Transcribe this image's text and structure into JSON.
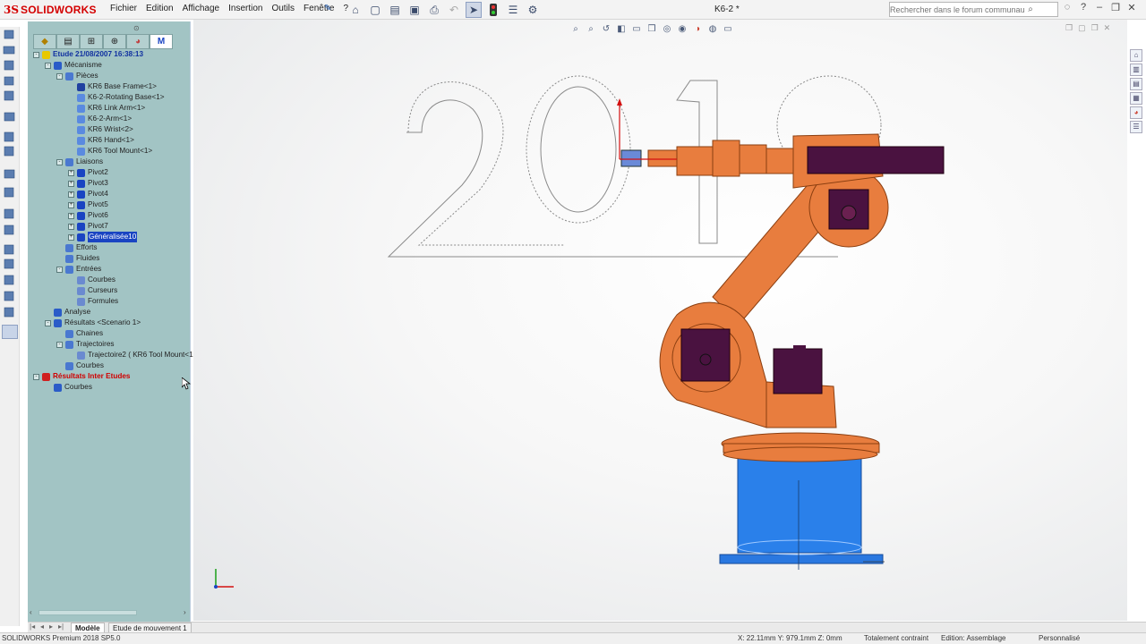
{
  "app": {
    "logo_ds": "3S",
    "logo_name": "SOLIDWORKS",
    "doc_title": "K6-2 *",
    "search_placeholder": "Rechercher dans le forum communautaire"
  },
  "menus": [
    "Fichier",
    "Edition",
    "Affichage",
    "Insertion",
    "Outils",
    "Fenêtre",
    "?"
  ],
  "top_toolbar_icons": [
    "home-icon",
    "new-file-icon",
    "open-file-icon",
    "save-icon",
    "print-icon",
    "undo-icon",
    "select-icon",
    "traffic-light-icon",
    "options-list-icon",
    "gear-icon"
  ],
  "window_controls": [
    "help-icon",
    "minimize-icon",
    "restore-icon",
    "close-icon"
  ],
  "panel_tabs": [
    "feature-manager-icon",
    "property-manager-icon",
    "configuration-manager-icon",
    "dimxpert-icon",
    "display-manager-icon",
    "meca3d-icon"
  ],
  "tree": [
    {
      "label": "Etude 21/08/2007 16:38:13",
      "level": 0,
      "toggle": "-",
      "style": "blue",
      "icon": "#e8c800"
    },
    {
      "label": "Mécanisme",
      "level": 1,
      "toggle": "-",
      "icon": "#2a5cc8"
    },
    {
      "label": "Pièces",
      "level": 2,
      "toggle": "-",
      "icon": "#4a78d0"
    },
    {
      "label": "KR6 Base Frame<1>",
      "level": 3,
      "icon": "#2040a0"
    },
    {
      "label": "K6-2-Rotating Base<1>",
      "level": 3,
      "icon": "#5a8ae0"
    },
    {
      "label": "KR6 Link Arm<1>",
      "level": 3,
      "icon": "#5a8ae0"
    },
    {
      "label": "K6-2-Arm<1>",
      "level": 3,
      "icon": "#5a8ae0"
    },
    {
      "label": "KR6 Wrist<2>",
      "level": 3,
      "icon": "#5a8ae0"
    },
    {
      "label": "KR6 Hand<1>",
      "level": 3,
      "icon": "#5a8ae0"
    },
    {
      "label": "KR6 Tool Mount<1>",
      "level": 3,
      "icon": "#5a8ae0"
    },
    {
      "label": "Liaisons",
      "level": 2,
      "toggle": "-",
      "icon": "#4a78d0"
    },
    {
      "label": "Pivot2",
      "level": 3,
      "toggle": "+",
      "icon": "#1a44c2"
    },
    {
      "label": "Pivot3",
      "level": 3,
      "toggle": "+",
      "icon": "#1a44c2"
    },
    {
      "label": "Pivot4",
      "level": 3,
      "toggle": "+",
      "icon": "#1a44c2"
    },
    {
      "label": "Pivot5",
      "level": 3,
      "toggle": "+",
      "icon": "#1a44c2"
    },
    {
      "label": "Pivot6",
      "level": 3,
      "toggle": "+",
      "icon": "#1a44c2"
    },
    {
      "label": "Pivot7",
      "level": 3,
      "toggle": "+",
      "icon": "#1a44c2"
    },
    {
      "label": "Généralisée10",
      "level": 3,
      "toggle": "+",
      "icon": "#1a44c2",
      "highlight": true
    },
    {
      "label": "Efforts",
      "level": 2,
      "icon": "#4a78d0"
    },
    {
      "label": "Fluides",
      "level": 2,
      "icon": "#4a78d0"
    },
    {
      "label": "Entrées",
      "level": 2,
      "toggle": "-",
      "icon": "#4a78d0"
    },
    {
      "label": "Courbes",
      "level": 3,
      "icon": "#6a8ad0"
    },
    {
      "label": "Curseurs",
      "level": 3,
      "icon": "#6a8ad0"
    },
    {
      "label": "Formules",
      "level": 3,
      "icon": "#6a8ad0"
    },
    {
      "label": "Analyse",
      "level": 1,
      "icon": "#2a5cc8"
    },
    {
      "label": "Résultats <Scenario 1>",
      "level": 1,
      "toggle": "-",
      "icon": "#2a5cc8"
    },
    {
      "label": "Chaines",
      "level": 2,
      "icon": "#4a78d0"
    },
    {
      "label": "Trajectoires",
      "level": 2,
      "toggle": "-",
      "icon": "#4a78d0"
    },
    {
      "label": "Trajectoire2 ( KR6 Tool Mount<1",
      "level": 3,
      "icon": "#6a8ad0"
    },
    {
      "label": "Courbes",
      "level": 2,
      "icon": "#4a78d0"
    },
    {
      "label": "Résultats Inter Etudes",
      "level": 0,
      "toggle": "-",
      "style": "red",
      "icon": "#d02020"
    },
    {
      "label": "Courbes",
      "level": 1,
      "icon": "#2a5cc8"
    }
  ],
  "bottom_tabs": [
    "Modèle",
    "Etude de mouvement 1"
  ],
  "status": {
    "product": "SOLIDWORKS Premium 2018 SP5.0",
    "coords": "X: 22.11mm Y: 979.1mm Z: 0mm",
    "constraint": "Totalement contraint",
    "edition": "Edition: Assemblage",
    "custom": "Personnalisé"
  },
  "viewport": {
    "sketch_text": "2019",
    "view_toolbar_icons": [
      "zoom-fit-icon",
      "zoom-area-icon",
      "previous-view-icon",
      "section-view-icon",
      "dynamic-annotation-icon",
      "view-orientation-icon",
      "display-style-icon",
      "hide-show-icon",
      "appearance-icon",
      "scene-icon",
      "display-settings-icon"
    ],
    "right_panel_icons": [
      "design-library-icon",
      "file-explorer-icon",
      "view-palette-icon",
      "appearances-icon",
      "custom-properties-icon",
      "properties-icon"
    ]
  },
  "colors": {
    "panel_bg": "#a2c4c4",
    "arm_orange": "#e87d3e",
    "motor_purple": "#4a1240",
    "base_blue": "#2a78e0",
    "selection_blue": "#1a44c2",
    "brand_red": "#d40000"
  }
}
